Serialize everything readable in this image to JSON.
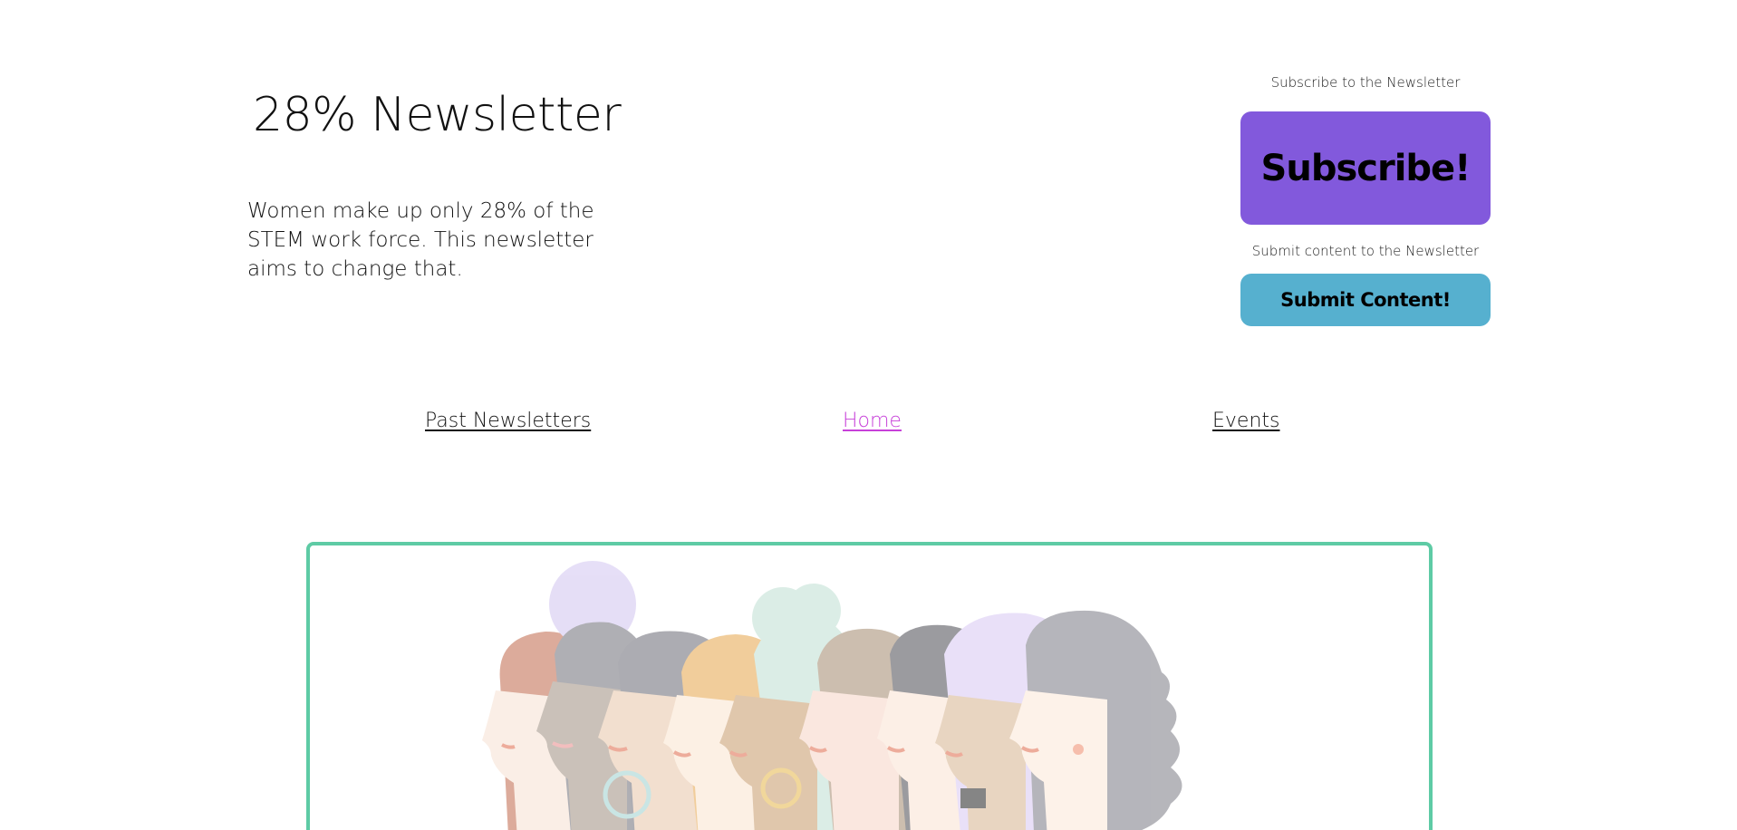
{
  "header": {
    "title": "28% Newsletter",
    "tagline": "Women make up only 28% of the STEM work force. This newsletter aims to change that."
  },
  "cta": {
    "subscribe_caption": "Subscribe to the Newsletter",
    "subscribe_label": "Subscribe!",
    "submit_caption": "Submit content to the Newsletter",
    "submit_label": "Submit Content!"
  },
  "nav": {
    "items": [
      {
        "label": "Past Newsletters",
        "active": false
      },
      {
        "label": "Home",
        "active": true
      },
      {
        "label": "Events",
        "active": false
      }
    ]
  },
  "hero": {
    "image": "women-profiles-illustration"
  },
  "colors": {
    "subscribe_button": "#8259dc",
    "submit_button": "#56b0cf",
    "active_link": "#c740d9",
    "hero_border": "#5ecba5"
  }
}
